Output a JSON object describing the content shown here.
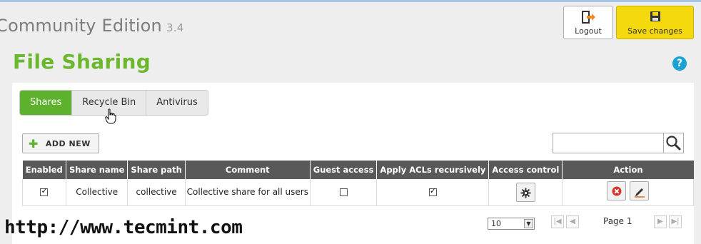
{
  "header": {
    "edition": "Community Edition",
    "version": "3.4",
    "logout_label": "Logout",
    "save_label": "Save changes"
  },
  "page": {
    "title": "File Sharing",
    "help": "?"
  },
  "tabs": [
    {
      "label": "Shares",
      "active": true
    },
    {
      "label": "Recycle Bin",
      "active": false
    },
    {
      "label": "Antivirus",
      "active": false
    }
  ],
  "toolbar": {
    "add_label": "ADD NEW",
    "search_value": "",
    "search_placeholder": ""
  },
  "table": {
    "columns": [
      "Enabled",
      "Share name",
      "Share path",
      "Comment",
      "Guest access",
      "Apply ACLs recursively",
      "Access control",
      "Action"
    ],
    "rows": [
      {
        "enabled": true,
        "share_name": "Collective",
        "share_path": "collective",
        "comment": "Collective share for all users",
        "guest_access": false,
        "apply_acls_recursively": true
      }
    ]
  },
  "pagination": {
    "page_size": "10",
    "page_label": "Page 1"
  },
  "watermark": "http://www.tecmint.com",
  "colors": {
    "accent_green": "#5db12c",
    "title_green": "#6bb82e",
    "save_yellow": "#f5d90f",
    "header_gray": "#595959",
    "help_blue": "#1aa2d4"
  }
}
